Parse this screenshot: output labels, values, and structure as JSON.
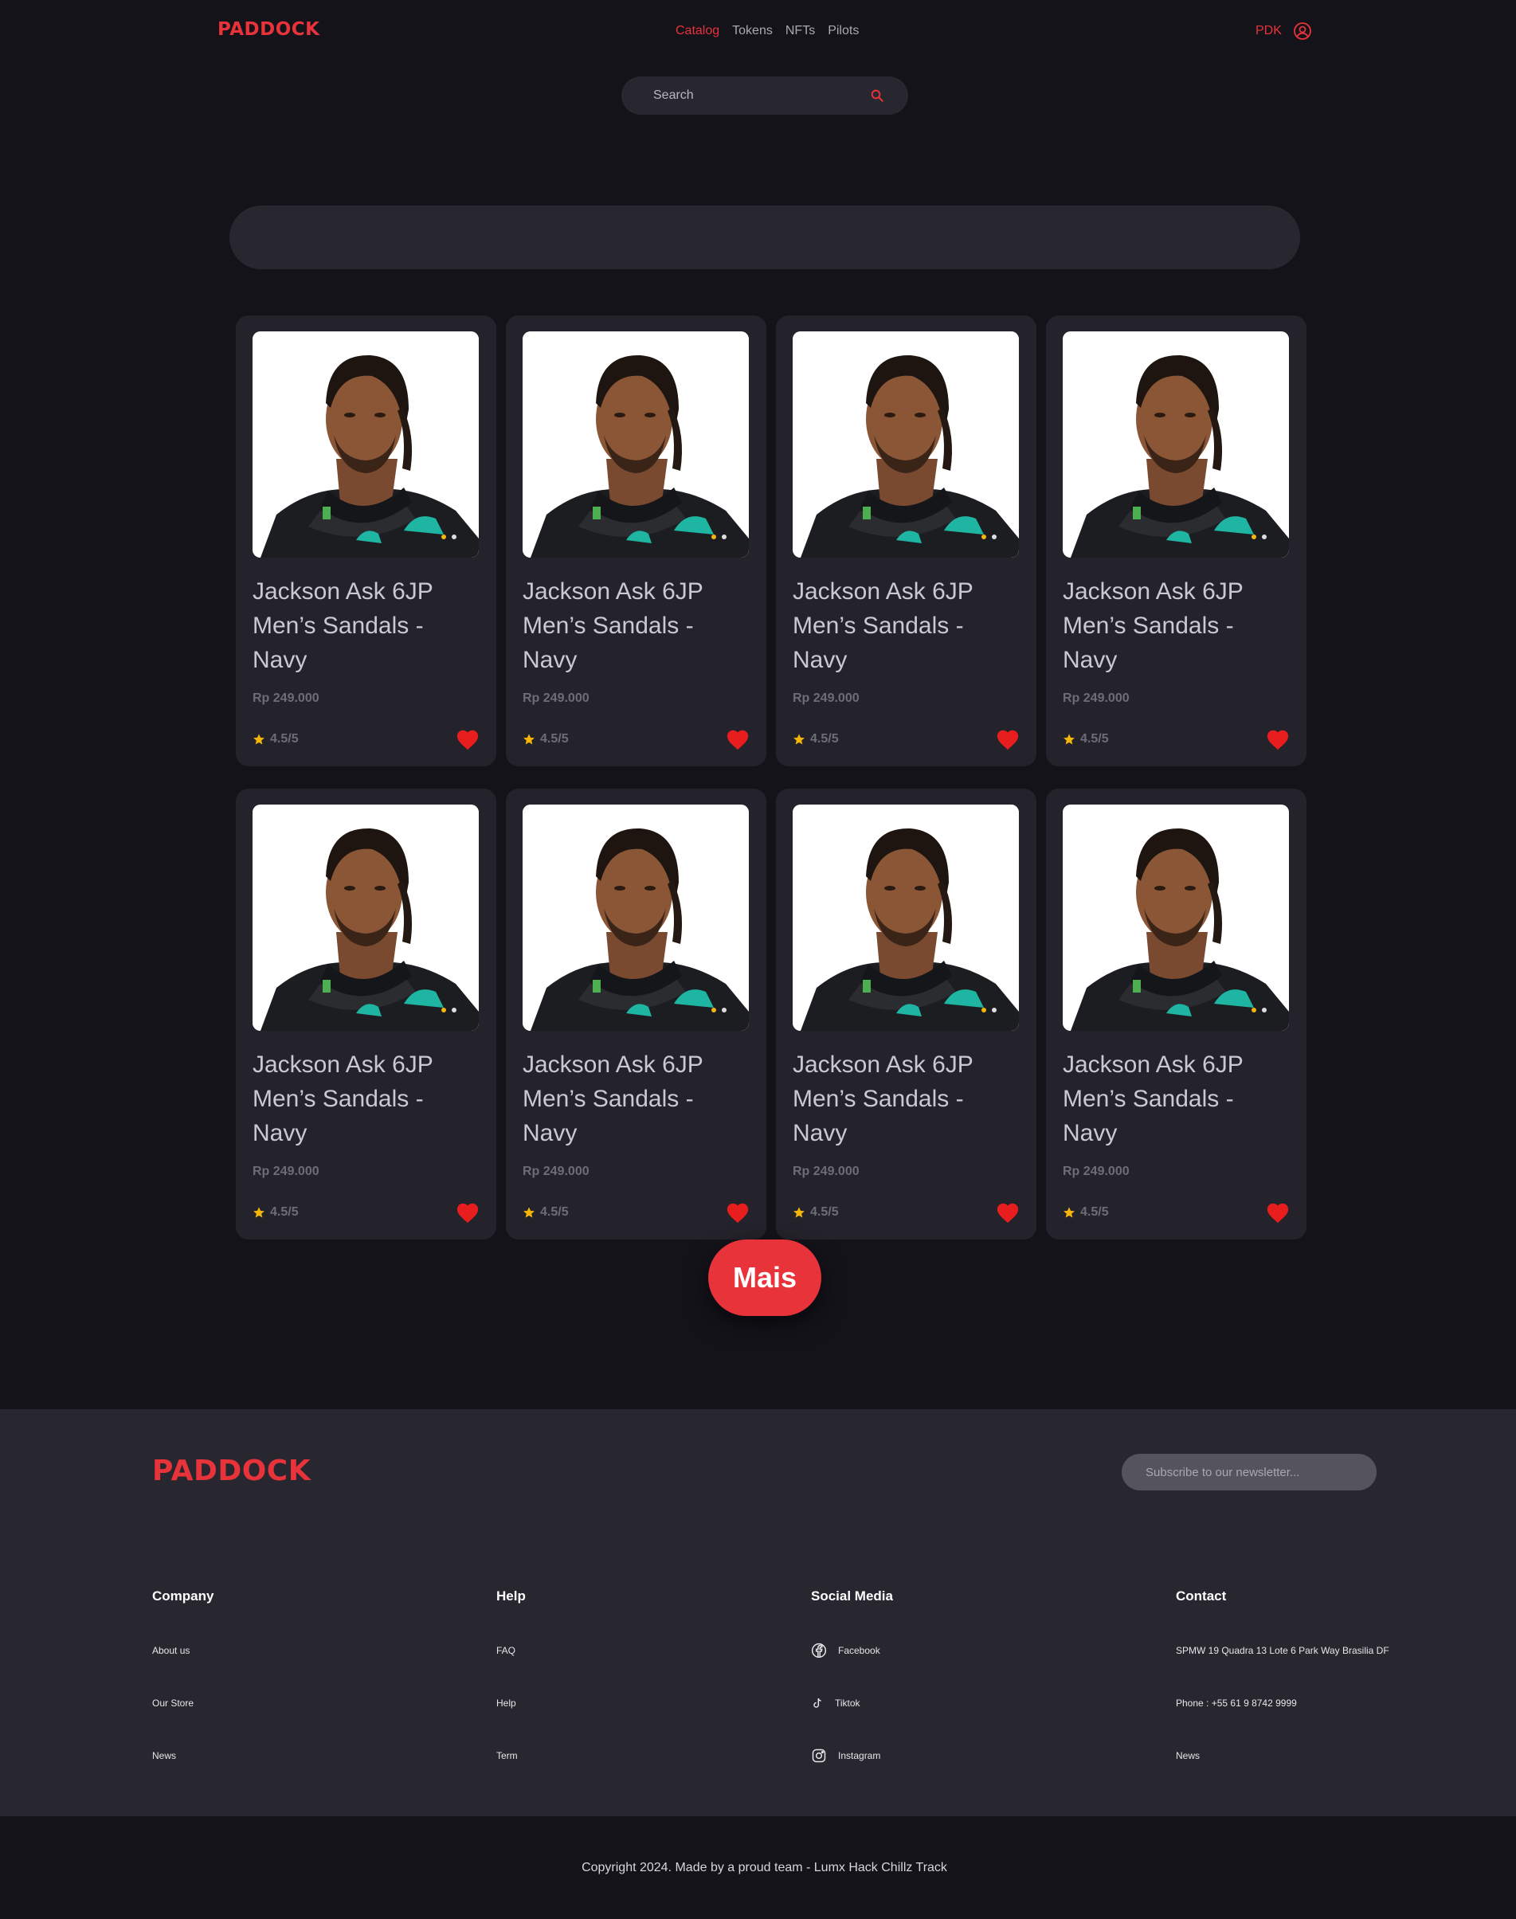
{
  "header": {
    "logo": "PADDOCK",
    "nav": [
      {
        "label": "Catalog",
        "active": true
      },
      {
        "label": "Tokens",
        "active": false
      },
      {
        "label": "NFTs",
        "active": false
      },
      {
        "label": "Pilots",
        "active": false
      }
    ],
    "currency": "PDK",
    "user_icon": "user-circle-icon"
  },
  "search": {
    "placeholder": "Search",
    "icon": "search-icon"
  },
  "products": [
    {
      "title": "Jackson Ask 6JP Men’s Sandals - Navy",
      "price": "Rp 249.000",
      "rating": "4.5/5",
      "favorited": true
    },
    {
      "title": "Jackson Ask 6JP Men’s Sandals - Navy",
      "price": "Rp 249.000",
      "rating": "4.5/5",
      "favorited": true
    },
    {
      "title": "Jackson Ask 6JP Men’s Sandals - Navy",
      "price": "Rp 249.000",
      "rating": "4.5/5",
      "favorited": true
    },
    {
      "title": "Jackson Ask 6JP Men’s Sandals - Navy",
      "price": "Rp 249.000",
      "rating": "4.5/5",
      "favorited": true
    },
    {
      "title": "Jackson Ask 6JP Men’s Sandals - Navy",
      "price": "Rp 249.000",
      "rating": "4.5/5",
      "favorited": true
    },
    {
      "title": "Jackson Ask 6JP Men’s Sandals - Navy",
      "price": "Rp 249.000",
      "rating": "4.5/5",
      "favorited": true
    },
    {
      "title": "Jackson Ask 6JP Men’s Sandals - Navy",
      "price": "Rp 249.000",
      "rating": "4.5/5",
      "favorited": true
    },
    {
      "title": "Jackson Ask 6JP Men’s Sandals - Navy",
      "price": "Rp 249.000",
      "rating": "4.5/5",
      "favorited": true
    }
  ],
  "more_button": "Mais",
  "footer": {
    "logo": "PADDOCK",
    "newsletter_placeholder": "Subscribe to our newsletter...",
    "columns": [
      {
        "heading": "Company",
        "links": [
          "About us",
          "Our Store",
          "News"
        ]
      },
      {
        "heading": "Help",
        "links": [
          "FAQ",
          "Help",
          "Term"
        ]
      },
      {
        "heading": "Social Media",
        "links": [
          {
            "label": "Facebook",
            "icon": "facebook-icon"
          },
          {
            "label": "Tiktok",
            "icon": "tiktok-icon"
          },
          {
            "label": "Instagram",
            "icon": "instagram-icon"
          }
        ]
      },
      {
        "heading": "Contact",
        "links": [
          "SPMW 19 Quadra 13 Lote 6 Park Way Brasilia DF",
          "Phone : +55 61 9 8742 9999",
          "News"
        ]
      }
    ],
    "copyright": "Copyright 2024. Made by a proud team - Lumx Hack Chillz Track"
  },
  "colors": {
    "background": "#14131a",
    "surface": "#24232b",
    "accent": "#e8333a",
    "star": "#f5b50a"
  }
}
